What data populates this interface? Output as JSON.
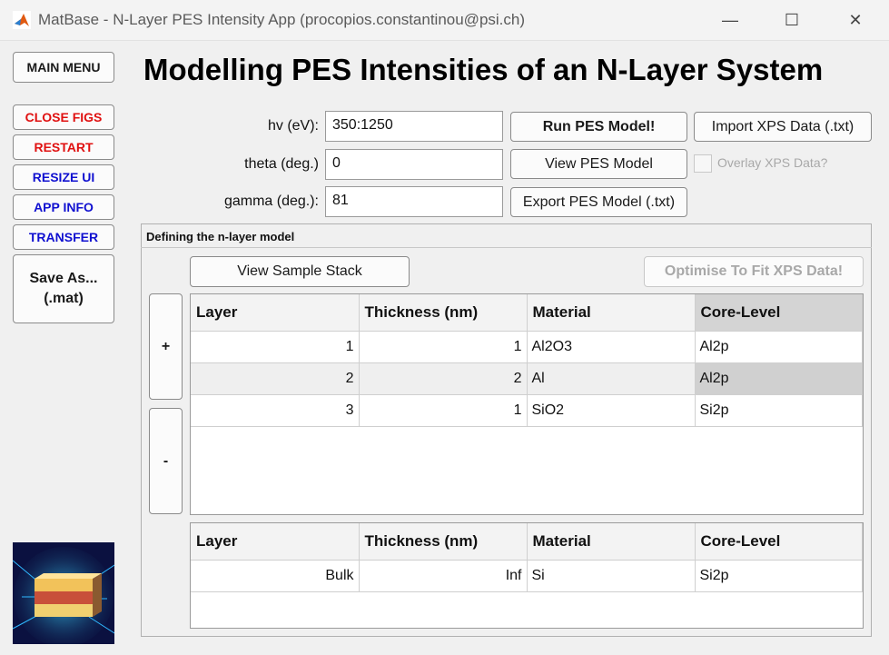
{
  "window": {
    "title": "MatBase - N-Layer PES Intensity App (procopios.constantinou@psi.ch)",
    "minimize_glyph": "—",
    "maximize_glyph": "☐",
    "close_glyph": "✕"
  },
  "sidebar": {
    "main_menu": "MAIN MENU",
    "close_figs": "CLOSE FIGS",
    "restart": "RESTART",
    "resize_ui": "RESIZE UI",
    "app_info": "APP INFO",
    "transfer": "TRANSFER",
    "save_as_line1": "Save As...",
    "save_as_line2": "(.mat)"
  },
  "heading": "Modelling PES Intensities of an N-Layer System",
  "inputs": {
    "hv_label": "hv (eV):",
    "hv_value": "350:1250",
    "theta_label": "theta (deg.)",
    "theta_value": "0",
    "gamma_label": "gamma (deg.):",
    "gamma_value": "81"
  },
  "actions": {
    "run": "Run PES Model!",
    "view": "View PES Model",
    "export": "Export PES Model (.txt)",
    "import": "Import XPS Data (.txt)",
    "overlay": "Overlay XPS Data?"
  },
  "panel": {
    "title": "Defining the n-layer model",
    "view_stack": "View Sample Stack",
    "optimise": "Optimise To Fit XPS Data!",
    "add": "+",
    "remove": "-"
  },
  "layers_table": {
    "columns": [
      "Layer",
      "Thickness (nm)",
      "Material",
      "Core-Level"
    ],
    "rows": [
      [
        "1",
        "1",
        "Al2O3",
        "Al2p"
      ],
      [
        "2",
        "2",
        "Al",
        "Al2p"
      ],
      [
        "3",
        "1",
        "SiO2",
        "Si2p"
      ]
    ]
  },
  "bulk_table": {
    "columns": [
      "Layer",
      "Thickness (nm)",
      "Material",
      "Core-Level"
    ],
    "rows": [
      [
        "Bulk",
        "Inf",
        "Si",
        "Si2p"
      ]
    ]
  }
}
